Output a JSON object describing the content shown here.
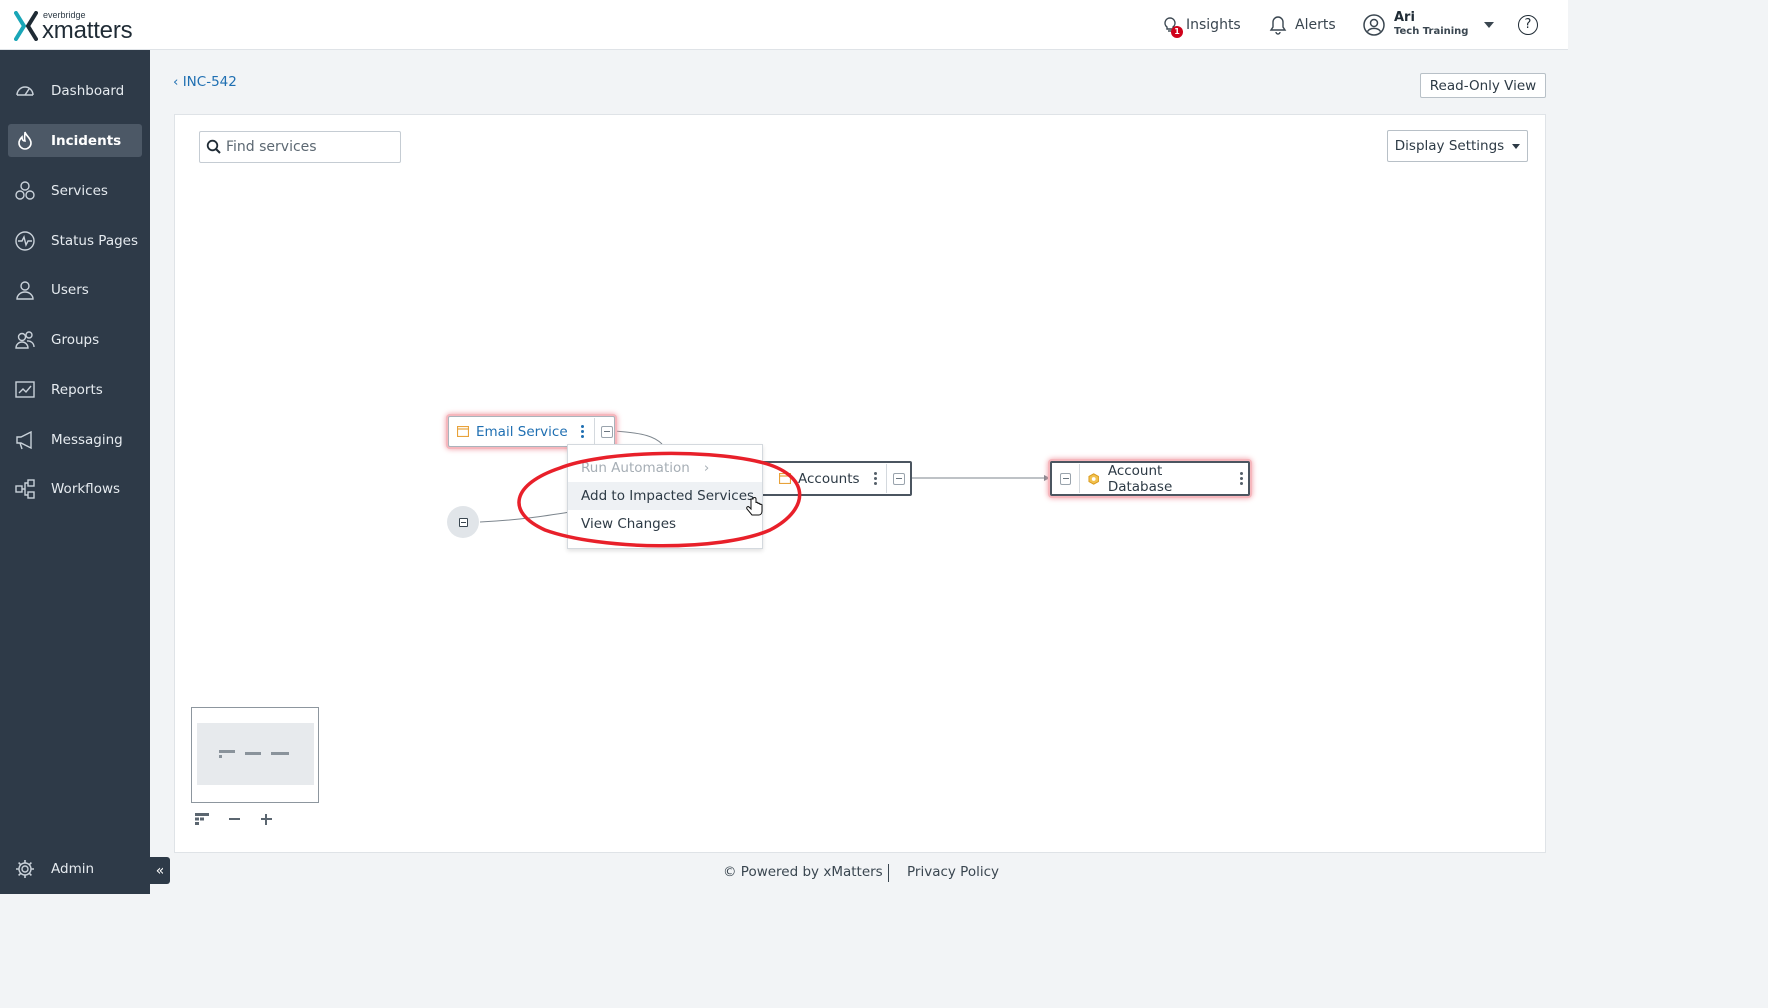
{
  "brand": {
    "sub": "everbridge",
    "main": "xmatters"
  },
  "topbar": {
    "insights_label": "Insights",
    "insights_badge": "1",
    "alerts_label": "Alerts",
    "user_name": "Ari",
    "user_org": "Tech Training",
    "help_glyph": "?"
  },
  "sidebar": {
    "items": [
      {
        "label": "Dashboard",
        "icon": "speedometer-icon"
      },
      {
        "label": "Incidents",
        "icon": "flame-icon",
        "active": true
      },
      {
        "label": "Services",
        "icon": "hexagons-icon"
      },
      {
        "label": "Status Pages",
        "icon": "pulse-icon"
      },
      {
        "label": "Users",
        "icon": "user-icon"
      },
      {
        "label": "Groups",
        "icon": "group-icon"
      },
      {
        "label": "Reports",
        "icon": "chart-icon"
      },
      {
        "label": "Messaging",
        "icon": "megaphone-icon"
      },
      {
        "label": "Workflows",
        "icon": "workflow-icon"
      }
    ],
    "admin_label": "Admin",
    "collapse_glyph": "«"
  },
  "main": {
    "breadcrumb": "INC-542",
    "read_only_label": "Read-Only View",
    "search_placeholder": "Find services",
    "display_settings_label": "Display Settings"
  },
  "graph": {
    "email_service": "Email Service",
    "accounts": "Accounts",
    "account_database": "Account Database"
  },
  "context_menu": {
    "items": [
      "Run Automation",
      "Add to Impacted Services",
      "View Changes"
    ],
    "submenu_glyph": "›"
  },
  "annotation_color": "#e8202a",
  "footer": {
    "powered_by": "© Powered by xMatters",
    "privacy": "Privacy Policy"
  }
}
